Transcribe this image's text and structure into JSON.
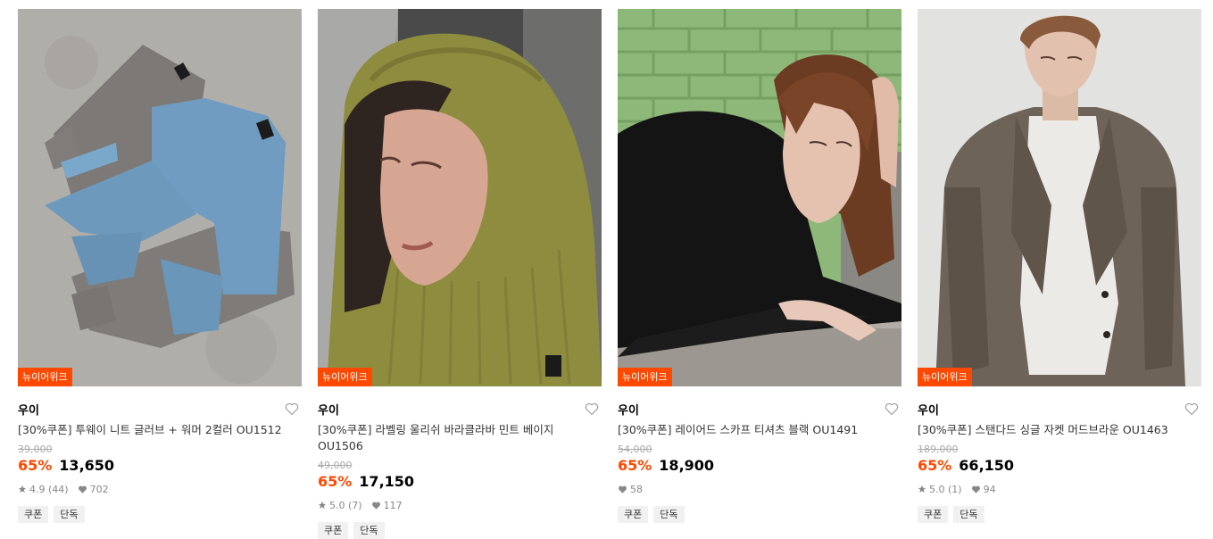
{
  "products": [
    {
      "badge": "뉴이어위크",
      "brand": "우이",
      "title": "[30%쿠폰] 투웨이 니트 글러브 + 워머 2컬러 OU1512",
      "original_price": "39,000",
      "discount": "65%",
      "price": "13,650",
      "rating": "4.9 (44)",
      "likes": "702",
      "tags": [
        "쿠폰",
        "단독"
      ]
    },
    {
      "badge": "뉴이어위크",
      "brand": "우이",
      "title": "[30%쿠폰] 라벨링 울리쉬 바라클라바 민트 베이지 OU1506",
      "original_price": "49,000",
      "discount": "65%",
      "price": "17,150",
      "rating": "5.0 (7)",
      "likes": "117",
      "tags": [
        "쿠폰",
        "단독"
      ]
    },
    {
      "badge": "뉴이어위크",
      "brand": "우이",
      "title": "[30%쿠폰] 레이어드 스카프 티셔츠 블랙 OU1491",
      "original_price": "54,000",
      "discount": "65%",
      "price": "18,900",
      "likes": "58",
      "tags": [
        "쿠폰",
        "단독"
      ]
    },
    {
      "badge": "뉴이어위크",
      "brand": "우이",
      "title": "[30%쿠폰] 스탠다드 싱글 자켓 머드브라운 OU1463",
      "original_price": "189,000",
      "discount": "65%",
      "price": "66,150",
      "rating": "5.0 (1)",
      "likes": "94",
      "tags": [
        "쿠폰",
        "단독"
      ]
    }
  ],
  "colors": {
    "accent": "#ff4800",
    "badge_bg": "#ff4800",
    "tag_bg": "#f1f1f1",
    "muted": "#888888"
  },
  "icons": {
    "wishlist": "heart-outline-icon",
    "rating": "star-icon",
    "likes": "heart-filled-icon"
  }
}
